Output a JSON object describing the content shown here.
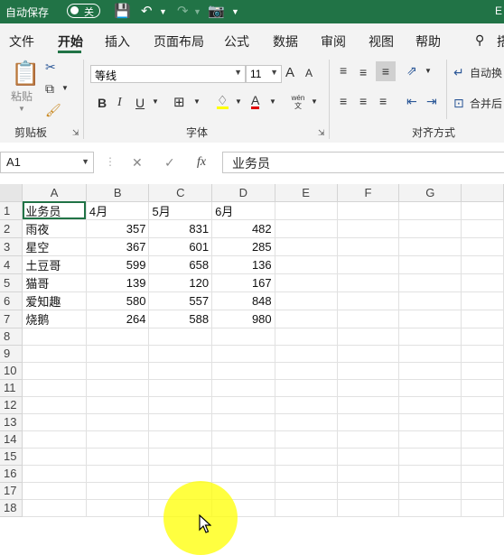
{
  "titlebar": {
    "autosave_label": "自动保存",
    "toggle_state": "关",
    "right_edge_text": "E"
  },
  "tabs": [
    "文件",
    "开始",
    "插入",
    "页面布局",
    "公式",
    "数据",
    "审阅",
    "视图",
    "帮助"
  ],
  "tab_cut": "搭",
  "ribbon": {
    "clipboard": {
      "paste_label": "粘贴",
      "group_label": "剪贴板"
    },
    "font": {
      "font_name": "等线",
      "font_size": "11",
      "group_label": "字体",
      "bold": "B",
      "italic": "I",
      "underline": "U",
      "grow": "A",
      "shrink": "A",
      "phonetic": "wén文"
    },
    "alignment": {
      "wrap_label": "自动换",
      "merge_label": "合并后",
      "group_label": "对齐方式"
    }
  },
  "formula_bar": {
    "name_box": "A1",
    "fx": "fx",
    "content": "业务员"
  },
  "sheet": {
    "columns": [
      "A",
      "B",
      "C",
      "D",
      "E",
      "F",
      "G"
    ],
    "rows": [
      [
        "业务员",
        "4月",
        "5月",
        "6月",
        "",
        "",
        ""
      ],
      [
        "雨夜",
        "357",
        "831",
        "482",
        "",
        "",
        ""
      ],
      [
        "星空",
        "367",
        "601",
        "285",
        "",
        "",
        ""
      ],
      [
        "土豆哥",
        "599",
        "658",
        "136",
        "",
        "",
        ""
      ],
      [
        "猫哥",
        "139",
        "120",
        "167",
        "",
        "",
        ""
      ],
      [
        "爱知趣",
        "580",
        "557",
        "848",
        "",
        "",
        ""
      ],
      [
        "烧鹅",
        "264",
        "588",
        "980",
        "",
        "",
        ""
      ],
      [
        "",
        "",
        "",
        "",
        "",
        "",
        ""
      ],
      [
        "",
        "",
        "",
        "",
        "",
        "",
        ""
      ],
      [
        "",
        "",
        "",
        "",
        "",
        "",
        ""
      ],
      [
        "",
        "",
        "",
        "",
        "",
        "",
        ""
      ],
      [
        "",
        "",
        "",
        "",
        "",
        "",
        ""
      ],
      [
        "",
        "",
        "",
        "",
        "",
        "",
        ""
      ],
      [
        "",
        "",
        "",
        "",
        "",
        "",
        ""
      ],
      [
        "",
        "",
        "",
        "",
        "",
        "",
        ""
      ],
      [
        "",
        "",
        "",
        "",
        "",
        "",
        ""
      ],
      [
        "",
        "",
        "",
        "",
        "",
        "",
        ""
      ],
      [
        "",
        "",
        "",
        "",
        "",
        "",
        ""
      ]
    ]
  },
  "colors": {
    "excel_green": "#217346",
    "highlight": "#ffff00"
  }
}
